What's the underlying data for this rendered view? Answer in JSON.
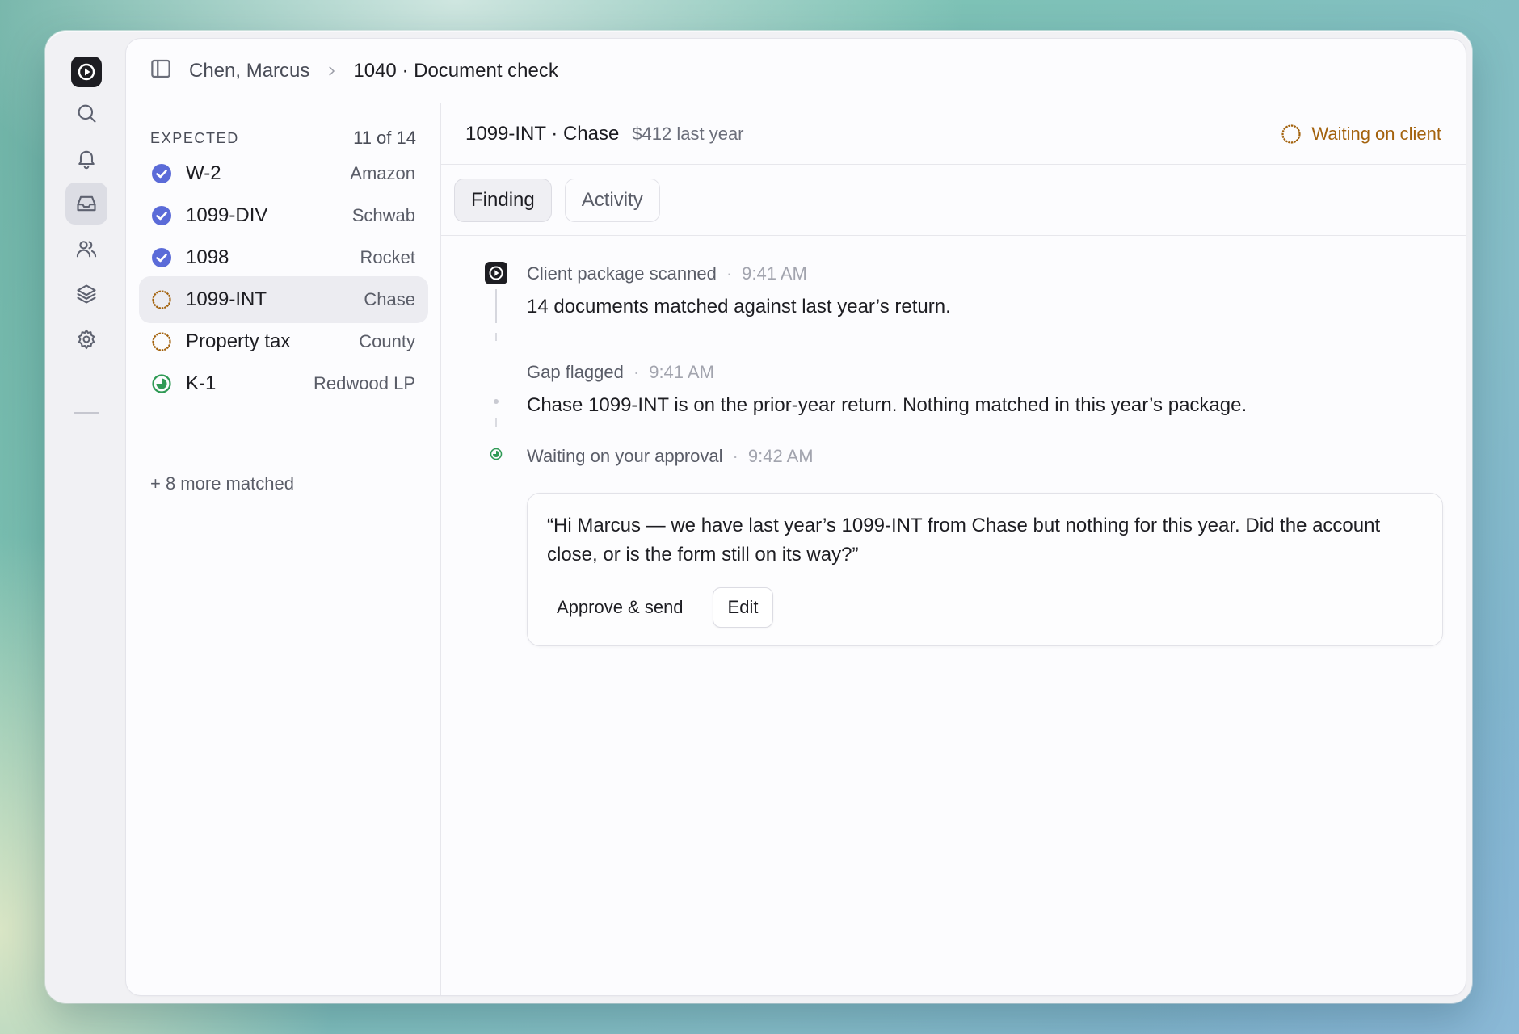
{
  "app": {
    "colors": {
      "accent_blue": "#5b6bd8",
      "pending_orange": "#a3620d",
      "done_green": "#2f9a55"
    }
  },
  "rail": {
    "items": [
      {
        "icon": "search-icon"
      },
      {
        "icon": "bell-icon"
      },
      {
        "icon": "inbox-icon",
        "active": true
      },
      {
        "icon": "users-icon"
      },
      {
        "icon": "layers-icon"
      },
      {
        "icon": "gear-icon"
      }
    ]
  },
  "breadcrumb": {
    "client": "Chen, Marcus",
    "page": "1040 · Document check"
  },
  "expected": {
    "label": "EXPECTED",
    "count": "11 of 14",
    "items": [
      {
        "name": "W-2",
        "issuer": "Amazon",
        "status": "checked"
      },
      {
        "name": "1099-DIV",
        "issuer": "Schwab",
        "status": "checked"
      },
      {
        "name": "1098",
        "issuer": "Rocket",
        "status": "checked"
      },
      {
        "name": "1099-INT",
        "issuer": "Chase",
        "status": "pending",
        "selected": true
      },
      {
        "name": "Property tax",
        "issuer": "County",
        "status": "pending"
      },
      {
        "name": "K-1",
        "issuer": "Redwood LP",
        "status": "in-progress"
      }
    ],
    "more": "+ 8 more matched"
  },
  "detail": {
    "title": "1099-INT · Chase",
    "amount": "$412 last year",
    "status": "Waiting on client",
    "tabs": [
      {
        "label": "Finding",
        "active": true
      },
      {
        "label": "Activity",
        "active": false
      }
    ]
  },
  "feed": {
    "events": [
      {
        "title": "Client package scanned",
        "time": "9:41 AM",
        "body": "14 documents matched against last year’s return."
      },
      {
        "title": "Gap flagged",
        "time": "9:41 AM",
        "body": "Chase 1099-INT is on the prior-year return. Nothing matched in this year’s package."
      },
      {
        "title": "Waiting on your approval",
        "time": "9:42 AM"
      }
    ],
    "draft": {
      "message": "“Hi Marcus — we have last year’s 1099-INT from Chase but nothing for this year. Did the account close, or is the form still on its way?”",
      "approve_label": "Approve & send",
      "edit_label": "Edit"
    }
  }
}
